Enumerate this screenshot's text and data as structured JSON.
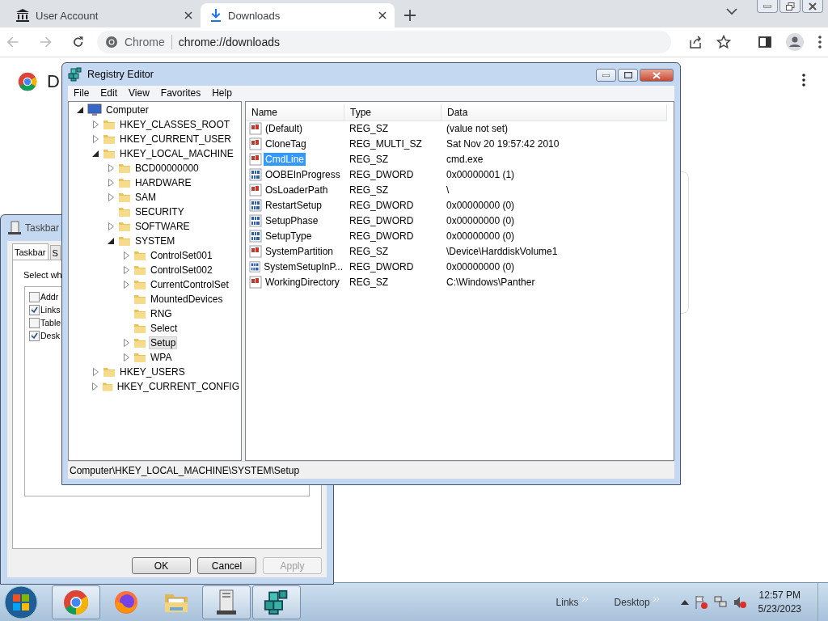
{
  "browser": {
    "tabs": [
      {
        "label": "User Account",
        "selected": false,
        "kind": "museum"
      },
      {
        "label": "Downloads",
        "selected": true,
        "kind": "download"
      }
    ],
    "address": {
      "site": "Chrome",
      "url": "chrome://downloads"
    },
    "page": {
      "heading": "D"
    }
  },
  "taskbar_dialog": {
    "title": "Taskbar",
    "tabs": [
      {
        "label": "Taskbar",
        "selected": true
      },
      {
        "label": "S",
        "selected": false
      }
    ],
    "prompt": "Select wh",
    "options": [
      {
        "label": "Addr",
        "checked": false
      },
      {
        "label": "Links",
        "checked": true
      },
      {
        "label": "Table",
        "checked": false
      },
      {
        "label": "Desk",
        "checked": true
      }
    ],
    "buttons": [
      {
        "label": "OK",
        "disabled": false
      },
      {
        "label": "Cancel",
        "disabled": false
      },
      {
        "label": "Apply",
        "disabled": true
      }
    ]
  },
  "registry_editor": {
    "title": "Registry Editor",
    "menu": [
      "File",
      "Edit",
      "View",
      "Favorites",
      "Help"
    ],
    "tree": [
      {
        "label": "Computer",
        "kind": "computer",
        "expandable": true,
        "expanded": true,
        "selected": false,
        "children": [
          {
            "label": "HKEY_CLASSES_ROOT",
            "kind": "folder",
            "expandable": true,
            "expanded": false,
            "selected": false
          },
          {
            "label": "HKEY_CURRENT_USER",
            "kind": "folder",
            "expandable": true,
            "expanded": false,
            "selected": false
          },
          {
            "label": "HKEY_LOCAL_MACHINE",
            "kind": "folder",
            "expandable": true,
            "expanded": true,
            "selected": false,
            "children": [
              {
                "label": "BCD00000000",
                "kind": "folder",
                "expandable": true,
                "expanded": false,
                "selected": false
              },
              {
                "label": "HARDWARE",
                "kind": "folder",
                "expandable": true,
                "expanded": false,
                "selected": false
              },
              {
                "label": "SAM",
                "kind": "folder",
                "expandable": true,
                "expanded": false,
                "selected": false
              },
              {
                "label": "SECURITY",
                "kind": "folder",
                "expandable": false,
                "selected": false
              },
              {
                "label": "SOFTWARE",
                "kind": "folder",
                "expandable": true,
                "expanded": false,
                "selected": false
              },
              {
                "label": "SYSTEM",
                "kind": "folder",
                "expandable": true,
                "expanded": true,
                "selected": false,
                "children": [
                  {
                    "label": "ControlSet001",
                    "kind": "folder",
                    "expandable": true,
                    "expanded": false,
                    "selected": false
                  },
                  {
                    "label": "ControlSet002",
                    "kind": "folder",
                    "expandable": true,
                    "expanded": false,
                    "selected": false
                  },
                  {
                    "label": "CurrentControlSet",
                    "kind": "folder",
                    "expandable": true,
                    "expanded": false,
                    "selected": false
                  },
                  {
                    "label": "MountedDevices",
                    "kind": "folder",
                    "expandable": false,
                    "selected": false
                  },
                  {
                    "label": "RNG",
                    "kind": "folder",
                    "expandable": false,
                    "selected": false
                  },
                  {
                    "label": "Select",
                    "kind": "folder",
                    "expandable": false,
                    "selected": false
                  },
                  {
                    "label": "Setup",
                    "kind": "folder",
                    "expandable": true,
                    "expanded": false,
                    "selected": true
                  },
                  {
                    "label": "WPA",
                    "kind": "folder",
                    "expandable": true,
                    "expanded": false,
                    "selected": false
                  }
                ]
              }
            ]
          },
          {
            "label": "HKEY_USERS",
            "kind": "folder",
            "expandable": true,
            "expanded": false,
            "selected": false
          },
          {
            "label": "HKEY_CURRENT_CONFIG",
            "kind": "folder",
            "expandable": true,
            "expanded": false,
            "selected": false
          }
        ]
      }
    ],
    "columns": [
      "Name",
      "Type",
      "Data"
    ],
    "values": [
      {
        "name": "(Default)",
        "type": "REG_SZ",
        "data": "(value not set)",
        "kind": "string",
        "selected": false
      },
      {
        "name": "CloneTag",
        "type": "REG_MULTI_SZ",
        "data": "Sat Nov 20 19:57:42 2010",
        "kind": "string",
        "selected": false
      },
      {
        "name": "CmdLine",
        "type": "REG_SZ",
        "data": "cmd.exe",
        "kind": "string",
        "selected": true
      },
      {
        "name": "OOBEInProgress",
        "type": "REG_DWORD",
        "data": "0x00000001 (1)",
        "kind": "binary",
        "selected": false
      },
      {
        "name": "OsLoaderPath",
        "type": "REG_SZ",
        "data": "\\",
        "kind": "string",
        "selected": false
      },
      {
        "name": "RestartSetup",
        "type": "REG_DWORD",
        "data": "0x00000000 (0)",
        "kind": "binary",
        "selected": false
      },
      {
        "name": "SetupPhase",
        "type": "REG_DWORD",
        "data": "0x00000000 (0)",
        "kind": "binary",
        "selected": false
      },
      {
        "name": "SetupType",
        "type": "REG_DWORD",
        "data": "0x00000000 (0)",
        "kind": "binary",
        "selected": false
      },
      {
        "name": "SystemPartition",
        "type": "REG_SZ",
        "data": "\\Device\\HarddiskVolume1",
        "kind": "string",
        "selected": false
      },
      {
        "name": "SystemSetupInP...",
        "type": "REG_DWORD",
        "data": "0x00000000 (0)",
        "kind": "binary",
        "selected": false
      },
      {
        "name": "WorkingDirectory",
        "type": "REG_SZ",
        "data": "C:\\Windows\\Panther",
        "kind": "string",
        "selected": false
      }
    ],
    "status": "Computer\\HKEY_LOCAL_MACHINE\\SYSTEM\\Setup"
  },
  "taskbar": {
    "apps": [
      {
        "kind": "chrome",
        "running": true
      },
      {
        "kind": "firefox",
        "running": false
      },
      {
        "kind": "explorer",
        "running": false
      },
      {
        "kind": "server",
        "running": true
      },
      {
        "kind": "registry",
        "running": true
      }
    ],
    "toolbars": [
      "Links",
      "Desktop"
    ],
    "clock": {
      "time": "12:57 PM",
      "date": "5/23/2023"
    }
  }
}
